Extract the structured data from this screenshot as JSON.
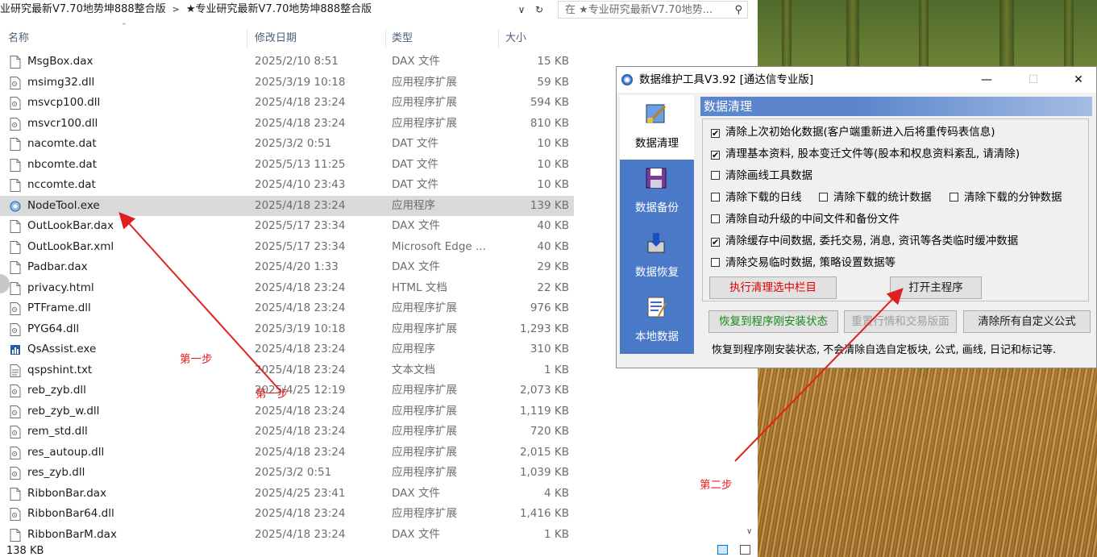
{
  "explorer": {
    "breadcrumb": [
      "业研究最新V7.70地势坤888整合版",
      "★专业研究最新V7.70地势坤888整合版"
    ],
    "search_placeholder": "在 ★专业研究最新V7.70地势...",
    "columns": {
      "name": "名称",
      "date": "修改日期",
      "type": "类型",
      "size": "大小"
    },
    "files": [
      {
        "name": "MsgBox.dax",
        "date": "2025/2/10 8:51",
        "type": "DAX 文件",
        "size": "15 KB",
        "icon": "file-icon"
      },
      {
        "name": "msimg32.dll",
        "date": "2025/3/19 10:18",
        "type": "应用程序扩展",
        "size": "59 KB",
        "icon": "dll-icon"
      },
      {
        "name": "msvcp100.dll",
        "date": "2025/4/18 23:24",
        "type": "应用程序扩展",
        "size": "594 KB",
        "icon": "dll-icon"
      },
      {
        "name": "msvcr100.dll",
        "date": "2025/4/18 23:24",
        "type": "应用程序扩展",
        "size": "810 KB",
        "icon": "dll-icon"
      },
      {
        "name": "nacomte.dat",
        "date": "2025/3/2 0:51",
        "type": "DAT 文件",
        "size": "10 KB",
        "icon": "file-icon"
      },
      {
        "name": "nbcomte.dat",
        "date": "2025/5/13 11:25",
        "type": "DAT 文件",
        "size": "10 KB",
        "icon": "file-icon"
      },
      {
        "name": "nccomte.dat",
        "date": "2025/4/10 23:43",
        "type": "DAT 文件",
        "size": "10 KB",
        "icon": "file-icon"
      },
      {
        "name": "NodeTool.exe",
        "date": "2025/4/18 23:24",
        "type": "应用程序",
        "size": "139 KB",
        "icon": "exe-icon",
        "selected": true
      },
      {
        "name": "OutLookBar.dax",
        "date": "2025/5/17 23:34",
        "type": "DAX 文件",
        "size": "40 KB",
        "icon": "file-icon"
      },
      {
        "name": "OutLookBar.xml",
        "date": "2025/5/17 23:34",
        "type": "Microsoft Edge ...",
        "size": "40 KB",
        "icon": "file-icon"
      },
      {
        "name": "Padbar.dax",
        "date": "2025/4/20 1:33",
        "type": "DAX 文件",
        "size": "29 KB",
        "icon": "file-icon"
      },
      {
        "name": "privacy.html",
        "date": "2025/4/18 23:24",
        "type": "HTML 文档",
        "size": "22 KB",
        "icon": "file-icon"
      },
      {
        "name": "PTFrame.dll",
        "date": "2025/4/18 23:24",
        "type": "应用程序扩展",
        "size": "976 KB",
        "icon": "dll-icon"
      },
      {
        "name": "PYG64.dll",
        "date": "2025/3/19 10:18",
        "type": "应用程序扩展",
        "size": "1,293 KB",
        "icon": "dll-icon"
      },
      {
        "name": "QsAssist.exe",
        "date": "2025/4/18 23:24",
        "type": "应用程序",
        "size": "310 KB",
        "icon": "chart-exe-icon"
      },
      {
        "name": "qspshint.txt",
        "date": "2025/4/18 23:24",
        "type": "文本文档",
        "size": "1 KB",
        "icon": "text-icon"
      },
      {
        "name": "reb_zyb.dll",
        "date": "2025/4/25 12:19",
        "type": "应用程序扩展",
        "size": "2,073 KB",
        "icon": "dll-icon"
      },
      {
        "name": "reb_zyb_w.dll",
        "date": "2025/4/18 23:24",
        "type": "应用程序扩展",
        "size": "1,119 KB",
        "icon": "dll-icon"
      },
      {
        "name": "rem_std.dll",
        "date": "2025/4/18 23:24",
        "type": "应用程序扩展",
        "size": "720 KB",
        "icon": "dll-icon"
      },
      {
        "name": "res_autoup.dll",
        "date": "2025/4/18 23:24",
        "type": "应用程序扩展",
        "size": "2,015 KB",
        "icon": "dll-icon"
      },
      {
        "name": "res_zyb.dll",
        "date": "2025/3/2 0:51",
        "type": "应用程序扩展",
        "size": "1,039 KB",
        "icon": "dll-icon"
      },
      {
        "name": "RibbonBar.dax",
        "date": "2025/4/25 23:41",
        "type": "DAX 文件",
        "size": "4 KB",
        "icon": "file-icon"
      },
      {
        "name": "RibbonBar64.dll",
        "date": "2025/4/18 23:24",
        "type": "应用程序扩展",
        "size": "1,416 KB",
        "icon": "dll-icon"
      },
      {
        "name": "RibbonBarM.dax",
        "date": "2025/4/18 23:24",
        "type": "DAX 文件",
        "size": "1 KB",
        "icon": "file-icon"
      }
    ],
    "status_text": "138 KB"
  },
  "dialog": {
    "title": "数据维护工具V3.92 [通达信专业版]",
    "nav": [
      {
        "label": "数据清理",
        "icon": "cleanup-icon",
        "active": true
      },
      {
        "label": "数据备份",
        "icon": "backup-icon",
        "active": false
      },
      {
        "label": "数据恢复",
        "icon": "restore-icon",
        "active": false
      },
      {
        "label": "本地数据",
        "icon": "local-data-icon",
        "active": false
      }
    ],
    "section_title": "数据清理",
    "options": {
      "opt1": {
        "label": "清除上次初始化数据(客户端重新进入后将重传码表信息)",
        "checked": true
      },
      "opt2": {
        "label": "清理基本资料, 股本变迁文件等(股本和权息资料紊乱, 请清除)",
        "checked": true
      },
      "opt3": {
        "label": "清除画线工具数据",
        "checked": false
      },
      "opt4a": {
        "label": "清除下载的日线",
        "checked": false
      },
      "opt4b": {
        "label": "清除下载的统计数据",
        "checked": false
      },
      "opt4c": {
        "label": "清除下载的分钟数据",
        "checked": false
      },
      "opt5": {
        "label": "清除自动升级的中间文件和备份文件",
        "checked": false
      },
      "opt6": {
        "label": "清除缓存中间数据, 委托交易, 消息, 资讯等各类临时缓冲数据",
        "checked": true
      },
      "opt7": {
        "label": "清除交易临时数据, 策略设置数据等",
        "checked": false
      }
    },
    "check_glyph": "✔",
    "buttons": {
      "execute": "执行清理选中栏目",
      "open_main": "打开主程序",
      "restore": "恢复到程序刚安装状态",
      "reset_layout": "重置行情和交易版面",
      "clear_formulas": "清除所有自定义公式"
    },
    "hint": "恢复到程序刚安装状态, 不会清除自选自定板块, 公式, 画线, 日记和标记等."
  },
  "annotations": {
    "step1": "第一步",
    "step2": "第二步"
  },
  "colors": {
    "nav_panel": "#4a7ac7",
    "section_header": "#5b86cc",
    "annotation_red": "#e02020",
    "selected_row": "#d9d9d9"
  }
}
